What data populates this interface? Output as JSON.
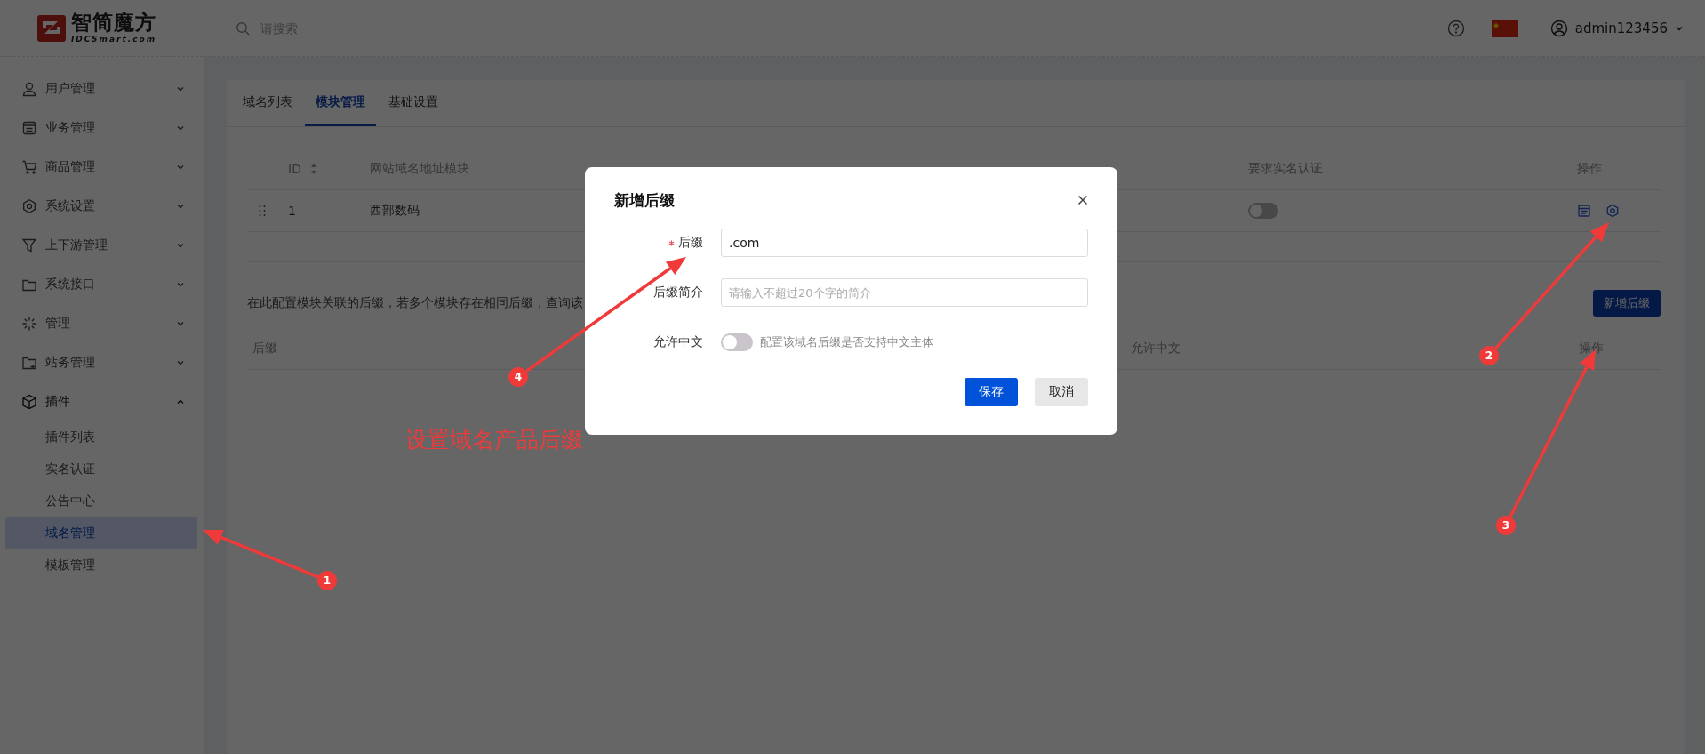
{
  "header": {
    "logo_name": "智简魔方",
    "logo_domain": "IDCSmart.com",
    "search": {
      "placeholder": "请搜索"
    },
    "user": "admin123456"
  },
  "sidebar": {
    "items": [
      {
        "label": "用户管理",
        "expanded": false
      },
      {
        "label": "业务管理",
        "expanded": false
      },
      {
        "label": "商品管理",
        "expanded": false
      },
      {
        "label": "系统设置",
        "expanded": false
      },
      {
        "label": "上下游管理",
        "expanded": false
      },
      {
        "label": "系统接口",
        "expanded": false
      },
      {
        "label": "管理",
        "expanded": false
      },
      {
        "label": "站务管理",
        "expanded": false
      },
      {
        "label": "插件",
        "expanded": true,
        "children": [
          {
            "label": "插件列表",
            "selected": false
          },
          {
            "label": "实名认证",
            "selected": false
          },
          {
            "label": "公告中心",
            "selected": false
          },
          {
            "label": "域名管理",
            "selected": true
          },
          {
            "label": "模板管理",
            "selected": false
          }
        ]
      }
    ]
  },
  "tabs": [
    {
      "label": "域名列表",
      "selected": false
    },
    {
      "label": "模块管理",
      "selected": true
    },
    {
      "label": "基础设置",
      "selected": false
    }
  ],
  "module_table": {
    "columns": [
      {
        "label": "ID",
        "sortable": true
      },
      {
        "label": "网站域名地址模块",
        "sortable": false
      },
      {
        "label": "要求实名认证",
        "sortable": false
      },
      {
        "label": "操作",
        "sortable": false
      }
    ],
    "rows": [
      {
        "id": "1",
        "module": "西部数码",
        "real_name_required": false
      }
    ]
  },
  "suffix_section": {
    "description": "在此配置模块关联的后缀，若多个模块存在相同后缀，查询该",
    "add_button": "新增后缀",
    "columns": [
      "后缀",
      "允许中文",
      "操作"
    ]
  },
  "dialog": {
    "title": "新增后缀",
    "fields": [
      {
        "kind": "input",
        "label": "后缀",
        "required": true,
        "value": ".com"
      },
      {
        "kind": "input",
        "label": "后缀简介",
        "required": false,
        "placeholder": "请输入不超过20个字的简介"
      },
      {
        "kind": "switch",
        "label": "允许中文",
        "required": false,
        "on": false,
        "hint": "配置该域名后缀是否支持中文主体"
      }
    ],
    "buttons": [
      {
        "label": "保存",
        "kind": "primary"
      },
      {
        "label": "取消",
        "kind": "secondary"
      }
    ]
  },
  "annotations": {
    "caption": "设置域名产品后缀",
    "steps": [
      "1",
      "2",
      "3",
      "4"
    ]
  }
}
